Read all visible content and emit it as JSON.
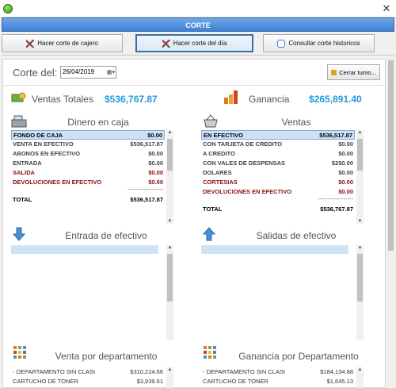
{
  "window": {
    "title": "CORTE"
  },
  "toolbar": {
    "corte_cajero": "Hacer corte de cajero",
    "corte_dia": "Hacer corte del día",
    "consultar": "Consultar corte historicos"
  },
  "header": {
    "corte_label": "Corte del:",
    "date": "26/04/2019",
    "cerrar": "Cerrar turno..."
  },
  "stats": {
    "ventas_label": "Ventas Totales",
    "ventas_value": "$536,767.87",
    "ganancia_label": "Ganancia",
    "ganancia_value": "$265,891.40"
  },
  "dinero": {
    "title": "Dinero en caja",
    "rows": [
      {
        "label": "FONDO DE CAJA",
        "value": "$0.00"
      },
      {
        "label": "VENTA EN EFECTIVO",
        "value": "$536,517.87"
      },
      {
        "label": "ABONOS EN EFECTIVO",
        "value": "$0.00"
      },
      {
        "label": "ENTRADA",
        "value": "$0.00"
      },
      {
        "label": "SALIDA",
        "value": "$0.00"
      },
      {
        "label": "DEVOLUCIONES EN EFECTIVO",
        "value": "$0.00"
      }
    ],
    "dashes": "------------------",
    "total_label": "TOTAL",
    "total_value": "$536,517.87"
  },
  "ventas": {
    "title": "Ventas",
    "rows": [
      {
        "label": "EN EFECTIVO",
        "value": "$536,517.87"
      },
      {
        "label": "CON TARJETA DE CREDITO",
        "value": "$0.00"
      },
      {
        "label": "A CREDITO",
        "value": "$0.00"
      },
      {
        "label": "CON VALES DE DESPENSAS",
        "value": "$250.00"
      },
      {
        "label": "DOLARES",
        "value": "$0.00"
      },
      {
        "label": "CORTESIAS",
        "value": "$0.00"
      },
      {
        "label": "DEVOLUCIONES EN EFECTIVO",
        "value": "$0.00"
      }
    ],
    "dashes": "------------------",
    "total_label": "TOTAL",
    "total_value": "$536,767.87"
  },
  "entrada": {
    "title": "Entrada de efectivo"
  },
  "salidas": {
    "title": "Salidas de efectivo"
  },
  "depto": {
    "title": "Venta por departamento",
    "rows": [
      {
        "label": "- DEPARTAMENTO SIN CLASI",
        "value": "$310,224.66"
      },
      {
        "label": "CARTUCHO DE TONER",
        "value": "$3,939.61"
      }
    ]
  },
  "ganancia_depto": {
    "title": "Ganancia por Departamento",
    "rows": [
      {
        "label": "- DEPARTAMENTO SIN CLASI",
        "value": "$184,134.88"
      },
      {
        "label": "CARTUCHO DE TONER",
        "value": "$1,645.13"
      }
    ]
  },
  "colors": {
    "accent": "#1f9bd8",
    "banner": "#3f7ed3",
    "negative": "#8b1010"
  }
}
